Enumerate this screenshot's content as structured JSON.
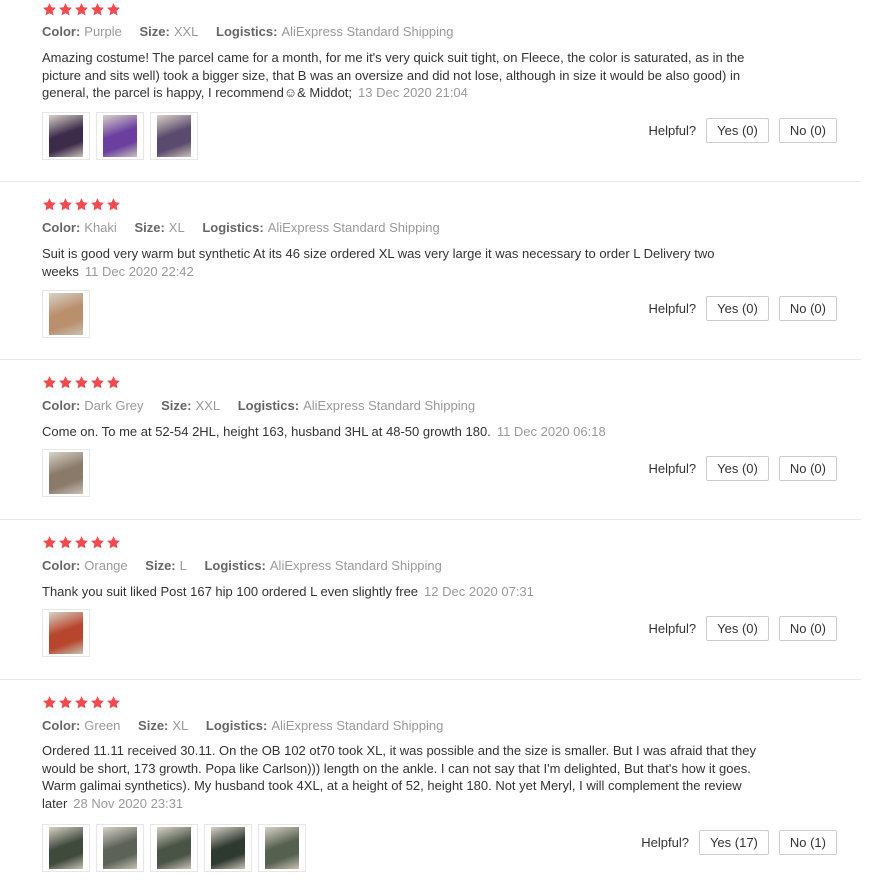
{
  "labels": {
    "color": "Color:",
    "size": "Size:",
    "logistics": "Logistics:",
    "helpful": "Helpful?"
  },
  "colors": {
    "star": "#f04b51",
    "meta_value": "#999999"
  },
  "reviews": [
    {
      "rating": 5,
      "color": "Purple",
      "size": "XXL",
      "logistics": "AliExpress Standard Shipping",
      "text": "Amazing costume! The parcel came for a month, for me it's very quick suit tight, on Fleece, the color is saturated, as in the picture and sits well) took a bigger size, that B was an oversize and did not lose, although in size it would be also good) in general, the parcel is happy, I recommend☺& Middot;",
      "date": "13 Dec 2020 21:04",
      "yes": "Yes (0)",
      "no": "No (0)",
      "photos": [
        "#3d2b4a",
        "#6a3fa0",
        "#5a4a6e"
      ]
    },
    {
      "rating": 5,
      "color": "Khaki",
      "size": "XL",
      "logistics": "AliExpress Standard Shipping",
      "text": "Suit is good very warm but synthetic At its 46 size ordered XL was very large it was necessary to order L Delivery two weeks",
      "date": "11 Dec 2020 22:42",
      "yes": "Yes (0)",
      "no": "No (0)",
      "photos": [
        "#b98f6c"
      ]
    },
    {
      "rating": 5,
      "color": "Dark Grey",
      "size": "XXL",
      "logistics": "AliExpress Standard Shipping",
      "text": "Come on. To me at 52-54 2HL, height 163, husband 3HL at 48-50 growth 180.",
      "date": "11 Dec 2020 06:18",
      "yes": "Yes (0)",
      "no": "No (0)",
      "photos": [
        "#8a7a6a"
      ]
    },
    {
      "rating": 5,
      "color": "Orange",
      "size": "L",
      "logistics": "AliExpress Standard Shipping",
      "text": "Thank you suit liked Post 167 hip 100 ordered L even slightly free",
      "date": "12 Dec 2020 07:31",
      "yes": "Yes (0)",
      "no": "No (0)",
      "photos": [
        "#b7462d"
      ]
    },
    {
      "rating": 5,
      "color": "Green",
      "size": "XL",
      "logistics": "AliExpress Standard Shipping",
      "text": "Ordered 11.11 received 30.11. On the OB 102 ot70 took XL, it was possible and the size is smaller. But I was afraid that they would be short, 173 growth. Popa like Carlson))) length on the ankle. I can not say that I'm delighted, But that's how it goes. Warm galimai synthetics). My husband took 4XL, at a height of 52, height 180. Not yet Meryl, I will complement the review later",
      "date": "28 Nov 2020 23:31",
      "yes": "Yes (17)",
      "no": "No (1)",
      "photos": [
        "#3f4a3c",
        "#5c6258",
        "#4a5446",
        "#2e3a30",
        "#56604f"
      ]
    }
  ]
}
